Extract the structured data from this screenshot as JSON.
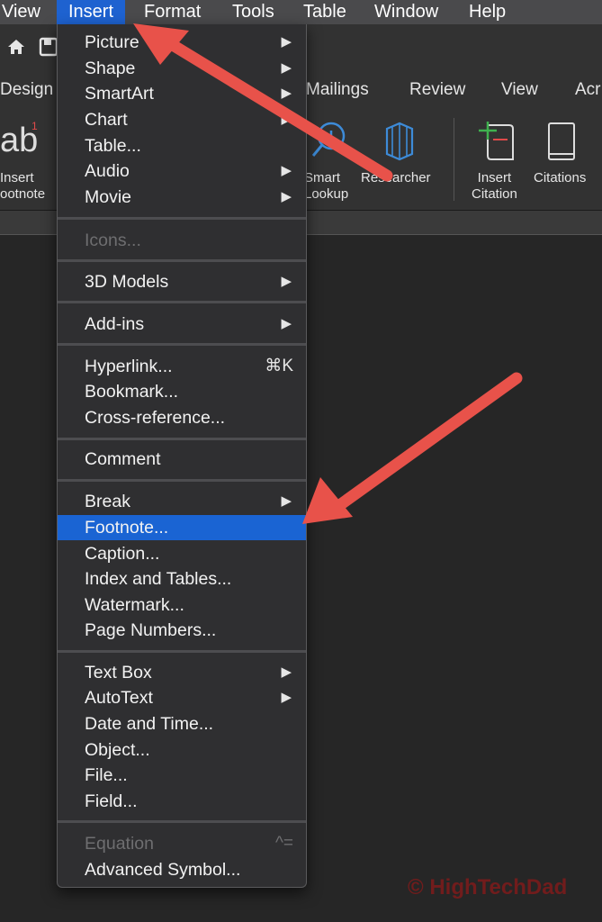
{
  "menubar": {
    "items": [
      "View",
      "Insert",
      "Format",
      "Tools",
      "Table",
      "Window",
      "Help"
    ],
    "active": "Insert"
  },
  "ribbon": {
    "tabs": [
      "Design",
      "Mailings",
      "Review",
      "View",
      "Acr"
    ],
    "buttons": {
      "insert_footnote": "Insert\nootnote",
      "smart_lookup": "Smart\nLookup",
      "researcher": "Researcher",
      "insert_citation": "Insert\nCitation",
      "citations": "Citations"
    },
    "footnote_glyph": "ab",
    "footnote_sup": "1"
  },
  "insert_menu": {
    "groups": [
      [
        {
          "label": "Picture",
          "submenu": true
        },
        {
          "label": "Shape",
          "submenu": true
        },
        {
          "label": "SmartArt",
          "submenu": true
        },
        {
          "label": "Chart",
          "submenu": true
        },
        {
          "label": "Table...",
          "submenu": false
        },
        {
          "label": "Audio",
          "submenu": true
        },
        {
          "label": "Movie",
          "submenu": true
        }
      ],
      [
        {
          "label": "Icons...",
          "submenu": false,
          "disabled": true
        }
      ],
      [
        {
          "label": "3D Models",
          "submenu": true
        }
      ],
      [
        {
          "label": "Add-ins",
          "submenu": true
        }
      ],
      [
        {
          "label": "Hyperlink...",
          "shortcut": "⌘K"
        },
        {
          "label": "Bookmark..."
        },
        {
          "label": "Cross-reference..."
        }
      ],
      [
        {
          "label": "Comment"
        }
      ],
      [
        {
          "label": "Break",
          "submenu": true
        },
        {
          "label": "Footnote...",
          "highlighted": true
        },
        {
          "label": "Caption..."
        },
        {
          "label": "Index and Tables..."
        },
        {
          "label": "Watermark..."
        },
        {
          "label": "Page Numbers..."
        }
      ],
      [
        {
          "label": "Text Box",
          "submenu": true
        },
        {
          "label": "AutoText",
          "submenu": true
        },
        {
          "label": "Date and Time..."
        },
        {
          "label": "Object..."
        },
        {
          "label": "File..."
        },
        {
          "label": "Field..."
        }
      ],
      [
        {
          "label": "Equation",
          "disabled": true,
          "shortcut": "^="
        },
        {
          "label": "Advanced Symbol..."
        }
      ]
    ]
  },
  "watermark": "© HighTechDad",
  "colors": {
    "highlight": "#1a64d3",
    "arrow": "#e8524a",
    "menubar_active": "#1e62d0"
  }
}
